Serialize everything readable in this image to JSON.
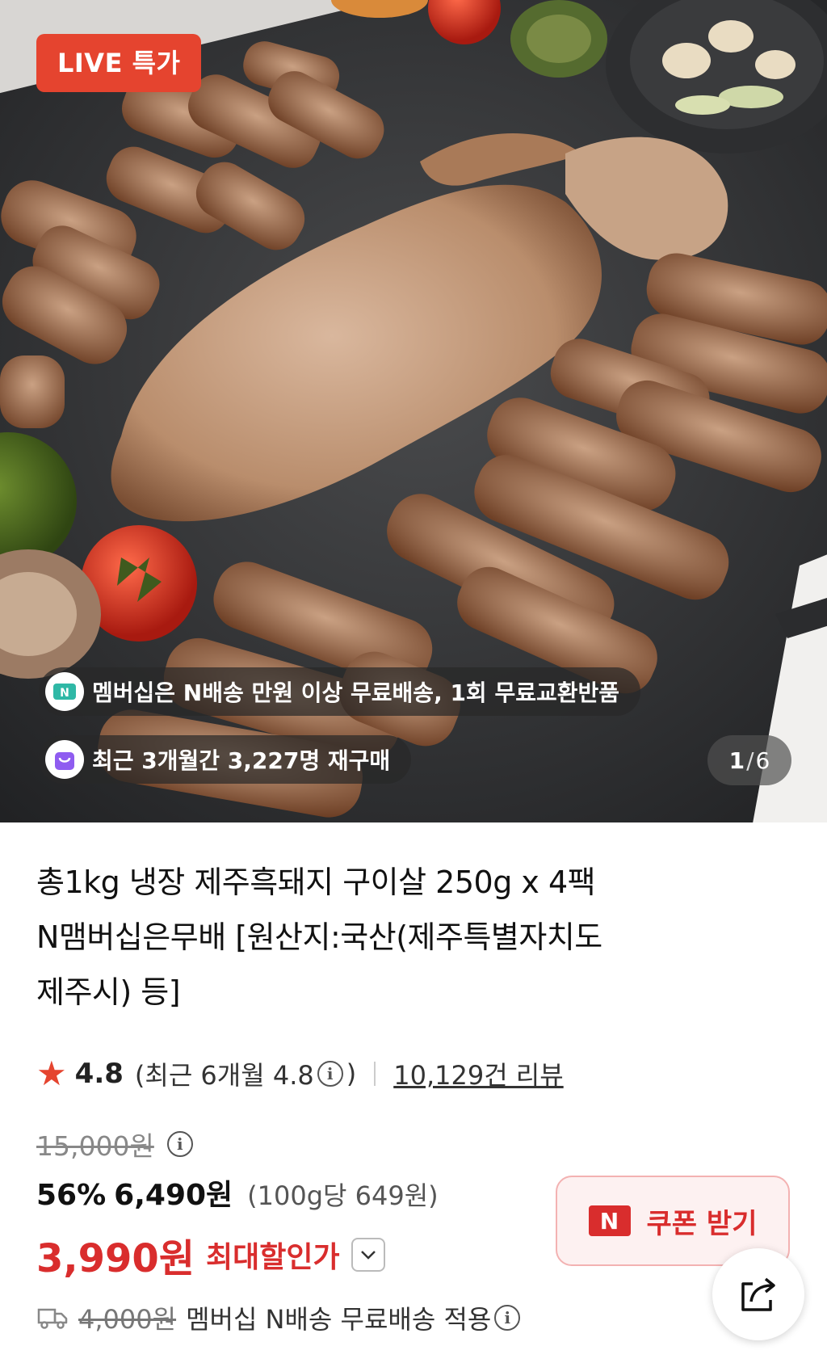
{
  "hero": {
    "badge": "LIVE 특가",
    "membership_notice": "멤버십은 N배송 만원 이상 무료배송, 1회 무료교환반품",
    "repurchase_notice": "최근 3개월간 3,227명 재구매",
    "counter_current": "1",
    "counter_sep": "/",
    "counter_total": "6"
  },
  "product": {
    "title_line1": "총1kg 냉장 제주흑돼지 구이살 250g x 4팩",
    "title_line2": "N맴버십은무배 [원산지:국산(제주특별자치도",
    "title_line3": "제주시) 등]"
  },
  "rating": {
    "score": "4.8",
    "recent_open": "(최근 6개월 4.8",
    "recent_close": ")",
    "reviews": "10,129건 리뷰"
  },
  "price": {
    "original": "15,000원",
    "discount": "56%",
    "price": "6,490원",
    "unit_price": "(100g당 649원)",
    "final": "3,990원",
    "final_label": "최대할인가"
  },
  "coupon": {
    "logo": "N",
    "label": "쿠폰 받기"
  },
  "shipping": {
    "original_fee": "4,000원",
    "text": "멤버십 N배송 무료배송 적용"
  },
  "icons": {
    "star": "star-icon",
    "info": "info-icon",
    "chevron": "chevron-down-icon",
    "share": "share-icon",
    "truck": "truck-icon",
    "membership": "n-delivery-icon",
    "repurchase": "shopping-bag-icon"
  },
  "colors": {
    "accent_red": "#d92d2d",
    "badge_red": "#e5442f",
    "coupon_bg": "#fdf1f1",
    "repurchase_purple": "#8f5cf0",
    "membership_teal": "#2fb8a6"
  }
}
